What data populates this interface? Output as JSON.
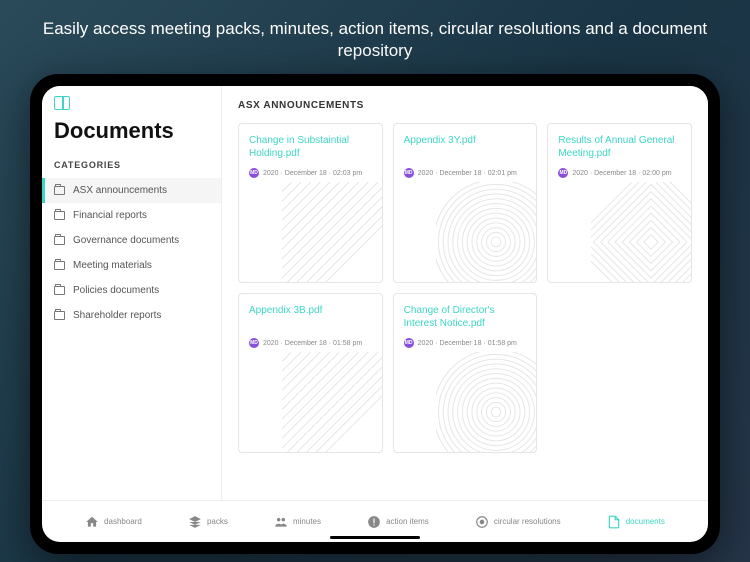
{
  "headline": "Easily access meeting packs, minutes, action items, circular resolutions and a document repository",
  "page_title": "Documents",
  "categories_label": "CATEGORIES",
  "categories": [
    {
      "label": "ASX announcements",
      "active": true
    },
    {
      "label": "Financial reports",
      "active": false
    },
    {
      "label": "Governance documents",
      "active": false
    },
    {
      "label": "Meeting materials",
      "active": false
    },
    {
      "label": "Policies documents",
      "active": false
    },
    {
      "label": "Shareholder reports",
      "active": false
    }
  ],
  "section_title": "ASX ANNOUNCEMENTS",
  "documents": [
    {
      "title": "Change in Substaintial Holding.pdf",
      "avatar": "MD",
      "date": "2020 · December 18 · 02:03 pm"
    },
    {
      "title": "Appendix 3Y.pdf",
      "avatar": "MD",
      "date": "2020 · December 18 · 02:01 pm"
    },
    {
      "title": "Results of Annual General Meeting.pdf",
      "avatar": "MD",
      "date": "2020 · December 18 · 02:00 pm"
    },
    {
      "title": "Appendix 3B.pdf",
      "avatar": "MD",
      "date": "2020 · December 18 · 01:58 pm"
    },
    {
      "title": "Change of Director's Interest Notice.pdf",
      "avatar": "MD",
      "date": "2020 · December 18 · 01:58 pm"
    }
  ],
  "nav": [
    {
      "label": "dashboard",
      "icon": "home",
      "active": false
    },
    {
      "label": "packs",
      "icon": "stack",
      "active": false
    },
    {
      "label": "minutes",
      "icon": "people",
      "active": false
    },
    {
      "label": "action items",
      "icon": "alert",
      "active": false
    },
    {
      "label": "circular resolutions",
      "icon": "circle",
      "active": false
    },
    {
      "label": "documents",
      "icon": "document",
      "active": true
    }
  ]
}
